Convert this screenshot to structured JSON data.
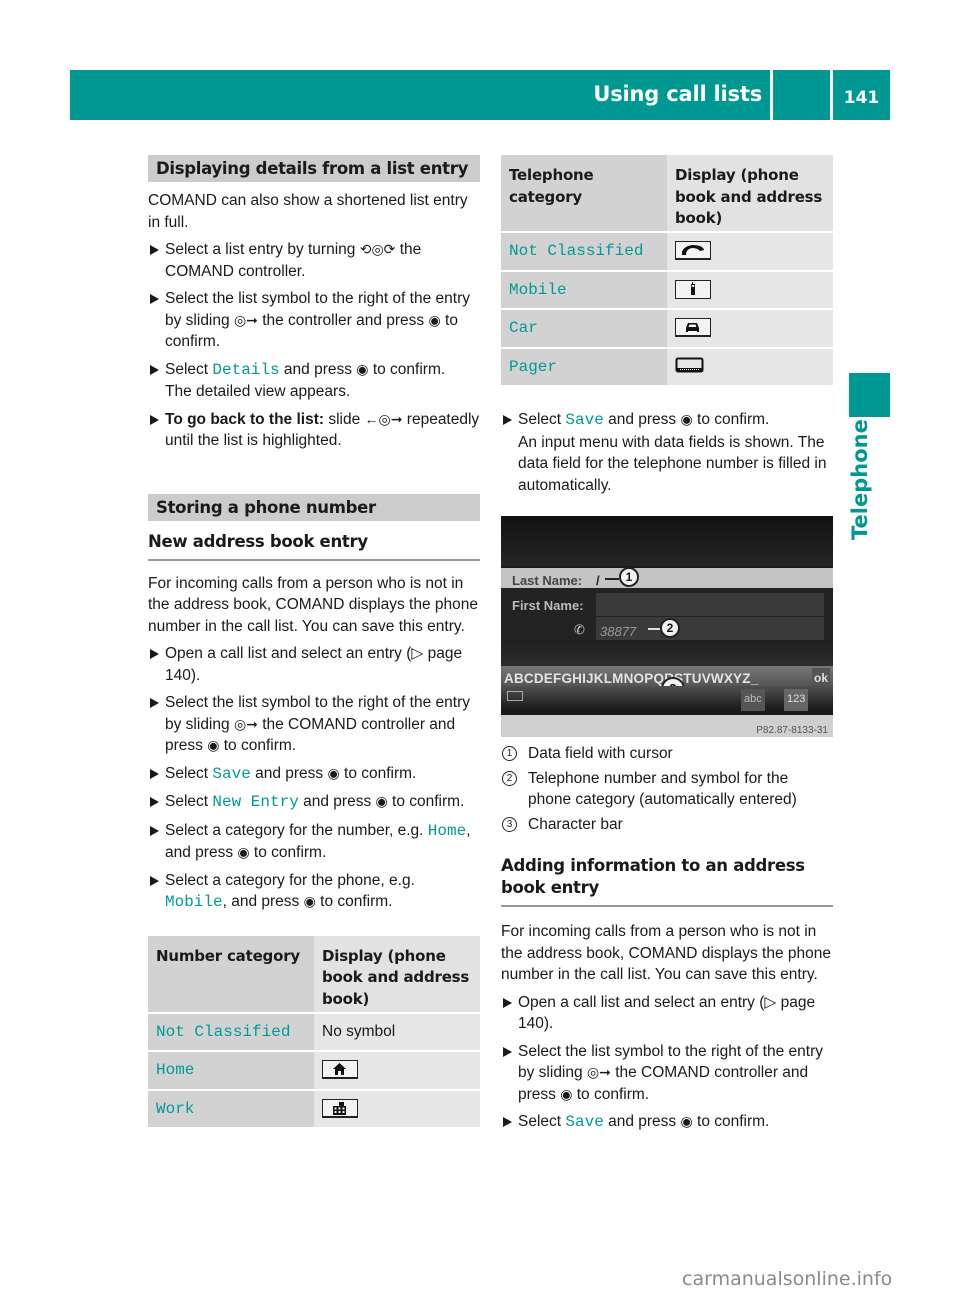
{
  "header": {
    "title": "Using call lists",
    "page_number": "141"
  },
  "side_tab": {
    "label": "Telephone"
  },
  "left": {
    "section1": {
      "heading": "Displaying details from a list entry",
      "intro": "COMAND can also show a shortened list entry in full.",
      "steps": [
        {
          "a": "Select a list entry by turning ",
          "sym": "⟲◎⟳",
          "b": " the COMAND controller."
        },
        {
          "a": "Select the list symbol to the right of the entry by sliding ",
          "sym": "◎➞",
          "b": " the controller and press ",
          "sym2": "◉",
          "c": " to confirm."
        },
        {
          "a": "Select ",
          "code": "Details",
          "b": " and press ",
          "sym": "◉",
          "c": " to confirm.",
          "result": "The detailed view appears."
        },
        {
          "bold": "To go back to the list:",
          "a": " slide ",
          "sym": "←◎➞",
          "b": " repeatedly until the list is highlighted."
        }
      ]
    },
    "section2": {
      "heading": "Storing a phone number",
      "subheading": "New address book entry",
      "intro": "For incoming calls from a person who is not in the address book, COMAND displays the phone number in the call list. You can save this entry.",
      "steps": [
        {
          "a": "Open a call list and select an entry (",
          "ref": "▷ page 140",
          "b": ")."
        },
        {
          "a": "Select the list symbol to the right of the entry by sliding ",
          "sym": "◎➞",
          "b": " the COMAND controller and press ",
          "sym2": "◉",
          "c": " to confirm."
        },
        {
          "a": "Select ",
          "code": "Save",
          "b": " and press ",
          "sym": "◉",
          "c": " to confirm."
        },
        {
          "a": "Select ",
          "code": "New Entry",
          "b": " and press ",
          "sym": "◉",
          "c": " to confirm."
        },
        {
          "a": "Select a category for the number, e.g. ",
          "code": "Home",
          "b": ", and press ",
          "sym": "◉",
          "c": " to confirm."
        },
        {
          "a": "Select a category for the phone, e.g. ",
          "code": "Mobile",
          "b": ", and press ",
          "sym": "◉",
          "c": " to confirm."
        }
      ]
    },
    "number_table": {
      "headers": [
        "Number category",
        "Display (phone book and address book)"
      ],
      "rows": [
        {
          "category": "Not Classified",
          "display": "No symbol",
          "icon": ""
        },
        {
          "category": "Home",
          "display": "",
          "icon": "home-icon"
        },
        {
          "category": "Work",
          "display": "",
          "icon": "office-building-icon"
        }
      ]
    }
  },
  "right": {
    "phone_table": {
      "headers": [
        "Telephone category",
        "Display (phone book and address book)"
      ],
      "rows": [
        {
          "category": "Not Classified",
          "icon": "handset-icon"
        },
        {
          "category": "Mobile",
          "icon": "mobile-phone-icon"
        },
        {
          "category": "Car",
          "icon": "car-icon"
        },
        {
          "category": "Pager",
          "icon": "pager-icon"
        }
      ]
    },
    "step_save": {
      "a": "Select ",
      "code": "Save",
      "b": " and press ",
      "sym": "◉",
      "c": " to confirm.",
      "result": "An input menu with data fields is shown. The data field for the telephone number is filled in automatically."
    },
    "screen": {
      "last_name_label": "Last Name:",
      "last_name_value": "/",
      "first_name_label": "First Name:",
      "phone_symbol": "✆",
      "phone_value": "38877",
      "char_bar": "ABCDEFGHIJKLMNOPQRSTUVWXYZ_",
      "ok_label": "ok",
      "abc_label": "abc",
      "num_label": "123",
      "image_code": "P82.87-8133-31",
      "callouts": [
        "1",
        "2",
        "3"
      ]
    },
    "legend": [
      {
        "num": "1",
        "text": "Data field with cursor"
      },
      {
        "num": "2",
        "text": "Telephone number and symbol for the phone category (automatically entered)"
      },
      {
        "num": "3",
        "text": "Character bar"
      }
    ],
    "section3": {
      "subheading": "Adding information to an address book entry",
      "intro": "For incoming calls from a person who is not in the address book, COMAND displays the phone number in the call list. You can save this entry.",
      "steps": [
        {
          "a": "Open a call list and select an entry (",
          "ref": "▷ page 140",
          "b": ")."
        },
        {
          "a": "Select the list symbol to the right of the entry by sliding ",
          "sym": "◎➞",
          "b": " the COMAND controller and press ",
          "sym2": "◉",
          "c": " to confirm."
        },
        {
          "a": "Select ",
          "code": "Save",
          "b": " and press ",
          "sym": "◉",
          "c": " to confirm."
        }
      ]
    }
  },
  "footer": {
    "watermark": "carmanualsonline.info"
  },
  "colors": {
    "brand_teal": "#009893",
    "code_teal": "#009a96"
  }
}
